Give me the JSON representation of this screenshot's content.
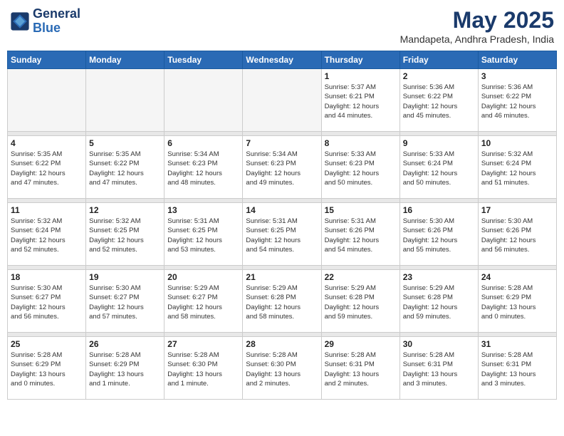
{
  "header": {
    "logo_line1": "General",
    "logo_line2": "Blue",
    "title": "May 2025",
    "subtitle": "Mandapeta, Andhra Pradesh, India"
  },
  "weekdays": [
    "Sunday",
    "Monday",
    "Tuesday",
    "Wednesday",
    "Thursday",
    "Friday",
    "Saturday"
  ],
  "weeks": [
    [
      {
        "day": "",
        "detail": ""
      },
      {
        "day": "",
        "detail": ""
      },
      {
        "day": "",
        "detail": ""
      },
      {
        "day": "",
        "detail": ""
      },
      {
        "day": "1",
        "detail": "Sunrise: 5:37 AM\nSunset: 6:21 PM\nDaylight: 12 hours\nand 44 minutes."
      },
      {
        "day": "2",
        "detail": "Sunrise: 5:36 AM\nSunset: 6:22 PM\nDaylight: 12 hours\nand 45 minutes."
      },
      {
        "day": "3",
        "detail": "Sunrise: 5:36 AM\nSunset: 6:22 PM\nDaylight: 12 hours\nand 46 minutes."
      }
    ],
    [
      {
        "day": "4",
        "detail": "Sunrise: 5:35 AM\nSunset: 6:22 PM\nDaylight: 12 hours\nand 47 minutes."
      },
      {
        "day": "5",
        "detail": "Sunrise: 5:35 AM\nSunset: 6:22 PM\nDaylight: 12 hours\nand 47 minutes."
      },
      {
        "day": "6",
        "detail": "Sunrise: 5:34 AM\nSunset: 6:23 PM\nDaylight: 12 hours\nand 48 minutes."
      },
      {
        "day": "7",
        "detail": "Sunrise: 5:34 AM\nSunset: 6:23 PM\nDaylight: 12 hours\nand 49 minutes."
      },
      {
        "day": "8",
        "detail": "Sunrise: 5:33 AM\nSunset: 6:23 PM\nDaylight: 12 hours\nand 50 minutes."
      },
      {
        "day": "9",
        "detail": "Sunrise: 5:33 AM\nSunset: 6:24 PM\nDaylight: 12 hours\nand 50 minutes."
      },
      {
        "day": "10",
        "detail": "Sunrise: 5:32 AM\nSunset: 6:24 PM\nDaylight: 12 hours\nand 51 minutes."
      }
    ],
    [
      {
        "day": "11",
        "detail": "Sunrise: 5:32 AM\nSunset: 6:24 PM\nDaylight: 12 hours\nand 52 minutes."
      },
      {
        "day": "12",
        "detail": "Sunrise: 5:32 AM\nSunset: 6:25 PM\nDaylight: 12 hours\nand 52 minutes."
      },
      {
        "day": "13",
        "detail": "Sunrise: 5:31 AM\nSunset: 6:25 PM\nDaylight: 12 hours\nand 53 minutes."
      },
      {
        "day": "14",
        "detail": "Sunrise: 5:31 AM\nSunset: 6:25 PM\nDaylight: 12 hours\nand 54 minutes."
      },
      {
        "day": "15",
        "detail": "Sunrise: 5:31 AM\nSunset: 6:26 PM\nDaylight: 12 hours\nand 54 minutes."
      },
      {
        "day": "16",
        "detail": "Sunrise: 5:30 AM\nSunset: 6:26 PM\nDaylight: 12 hours\nand 55 minutes."
      },
      {
        "day": "17",
        "detail": "Sunrise: 5:30 AM\nSunset: 6:26 PM\nDaylight: 12 hours\nand 56 minutes."
      }
    ],
    [
      {
        "day": "18",
        "detail": "Sunrise: 5:30 AM\nSunset: 6:27 PM\nDaylight: 12 hours\nand 56 minutes."
      },
      {
        "day": "19",
        "detail": "Sunrise: 5:30 AM\nSunset: 6:27 PM\nDaylight: 12 hours\nand 57 minutes."
      },
      {
        "day": "20",
        "detail": "Sunrise: 5:29 AM\nSunset: 6:27 PM\nDaylight: 12 hours\nand 58 minutes."
      },
      {
        "day": "21",
        "detail": "Sunrise: 5:29 AM\nSunset: 6:28 PM\nDaylight: 12 hours\nand 58 minutes."
      },
      {
        "day": "22",
        "detail": "Sunrise: 5:29 AM\nSunset: 6:28 PM\nDaylight: 12 hours\nand 59 minutes."
      },
      {
        "day": "23",
        "detail": "Sunrise: 5:29 AM\nSunset: 6:28 PM\nDaylight: 12 hours\nand 59 minutes."
      },
      {
        "day": "24",
        "detail": "Sunrise: 5:28 AM\nSunset: 6:29 PM\nDaylight: 13 hours\nand 0 minutes."
      }
    ],
    [
      {
        "day": "25",
        "detail": "Sunrise: 5:28 AM\nSunset: 6:29 PM\nDaylight: 13 hours\nand 0 minutes."
      },
      {
        "day": "26",
        "detail": "Sunrise: 5:28 AM\nSunset: 6:29 PM\nDaylight: 13 hours\nand 1 minute."
      },
      {
        "day": "27",
        "detail": "Sunrise: 5:28 AM\nSunset: 6:30 PM\nDaylight: 13 hours\nand 1 minute."
      },
      {
        "day": "28",
        "detail": "Sunrise: 5:28 AM\nSunset: 6:30 PM\nDaylight: 13 hours\nand 2 minutes."
      },
      {
        "day": "29",
        "detail": "Sunrise: 5:28 AM\nSunset: 6:31 PM\nDaylight: 13 hours\nand 2 minutes."
      },
      {
        "day": "30",
        "detail": "Sunrise: 5:28 AM\nSunset: 6:31 PM\nDaylight: 13 hours\nand 3 minutes."
      },
      {
        "day": "31",
        "detail": "Sunrise: 5:28 AM\nSunset: 6:31 PM\nDaylight: 13 hours\nand 3 minutes."
      }
    ]
  ]
}
